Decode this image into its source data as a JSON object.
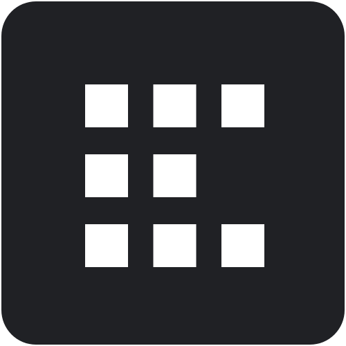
{
  "icon": {
    "name": "grid-dots-icon",
    "background_color": "#202125",
    "square_color": "#ffffff",
    "grid": [
      [
        true,
        true,
        true
      ],
      [
        true,
        true,
        false
      ],
      [
        true,
        true,
        true
      ]
    ]
  }
}
